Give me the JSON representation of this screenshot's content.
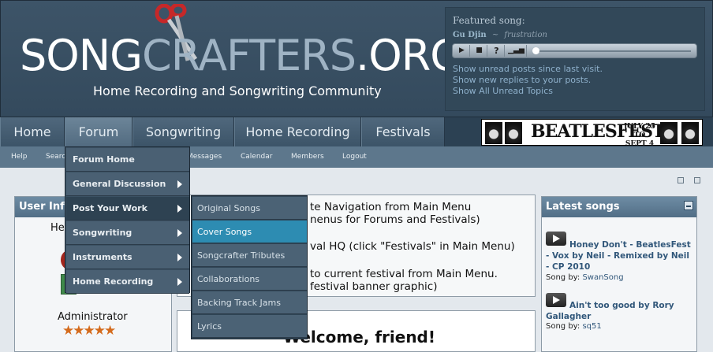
{
  "header": {
    "logo_primary": "SONG",
    "logo_secondary": "CRAFTERS",
    "logo_suffix": ".ORG",
    "tagline": "Home Recording and Songwriting Community"
  },
  "featured": {
    "title": "Featured song:",
    "artist": "Gu Djin",
    "separator": "~",
    "song": "frustration",
    "player": {
      "play": "▶",
      "stop": "■",
      "help": "?",
      "volume": "▁▃▅",
      "progress": 0
    },
    "links": [
      "Show unread posts since last visit.",
      "Show new replies to your posts.",
      "Show All Unread Topics"
    ]
  },
  "nav": {
    "items": [
      "Home",
      "Forum",
      "Songwriting",
      "Home Recording",
      "Festivals"
    ],
    "active": "Forum"
  },
  "banner": {
    "text": "BEATLESFEST",
    "date_line1": "JULY 25",
    "date_line2": "TO",
    "date_line3": "SEPT 4"
  },
  "subnav": {
    "items": [
      "Help",
      "Search",
      "Messages",
      "Calendar",
      "Members",
      "Logout"
    ]
  },
  "forum_menu": {
    "items": [
      "Forum Home",
      "General Discussion",
      "Post Your Work",
      "Songwriting",
      "Instruments",
      "Home Recording"
    ],
    "hovered": "Post Your Work"
  },
  "post_your_work_menu": {
    "items": [
      "Original Songs",
      "Cover Songs",
      "Songcrafter Tributes",
      "Collaborations",
      "Backing Track Jams",
      "Lyrics"
    ],
    "active": "Cover Songs"
  },
  "user_info": {
    "title": "User Info",
    "greeting": "Hello",
    "role": "Administrator",
    "stars": "★★★★★"
  },
  "main": {
    "lines": [
      "te Navigation from Main Menu",
      "nenus for Forums and Festivals)",
      "val HQ  (click \"Festivals\" in Main Menu)",
      "to current festival from Main Menu.",
      "festival banner graphic)"
    ],
    "welcome": "Welcome, friend!"
  },
  "latest_songs": {
    "title": "Latest songs",
    "songs": [
      {
        "title": "Honey Don't - BeatlesFest - Vox by Neil - Remixed by Neil - CP 2010",
        "by_label": "Song by:",
        "author": "SwanSong"
      },
      {
        "title": "Ain't too good by Rory Gallagher",
        "by_label": "Song by:",
        "author": "sq51"
      }
    ]
  },
  "colors": {
    "header_bg": "#3d5468",
    "nav_bg": "#3c5468",
    "accent": "#2d8cb2",
    "link": "#31577a",
    "star": "#d46b1d"
  }
}
